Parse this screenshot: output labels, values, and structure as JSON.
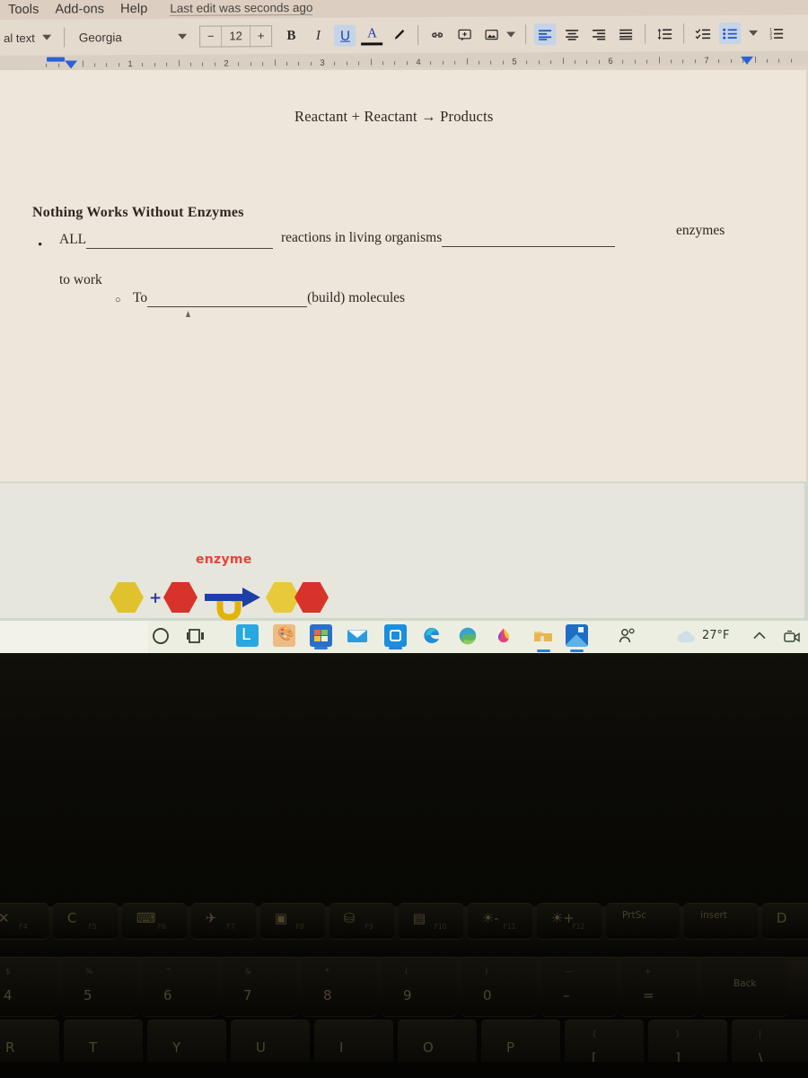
{
  "app": {
    "name": "Google Docs",
    "menu_items": [
      "Tools",
      "Add-ons",
      "Help"
    ],
    "last_edit": "Last edit was seconds ago"
  },
  "toolbar": {
    "paragraph_style": "al text",
    "font_family": "Georgia",
    "font_size": "12",
    "size_decrease": "−",
    "size_increase": "+",
    "bold_label": "B",
    "italic_label": "I",
    "underline_label": "U",
    "text_color_label": "A",
    "highlight_icon": "pen-highlight-icon",
    "link_icon": "insert-link-icon",
    "comment_icon": "add-comment-icon",
    "image_icon": "insert-image-icon",
    "align_left_icon": "align-left-icon",
    "align_center_icon": "align-center-icon",
    "align_right_icon": "align-right-icon",
    "align_justify_icon": "align-justify-icon",
    "line_spacing_icon": "line-spacing-icon",
    "checklist_icon": "checklist-icon",
    "bulleted_list_icon": "bulleted-list-icon",
    "numbered_list_icon": "numbered-list-icon",
    "active_buttons": [
      "underline",
      "align-left",
      "bulleted-list"
    ]
  },
  "ruler": {
    "numbers": [
      "1",
      "2",
      "3",
      "4",
      "5",
      "6",
      "7"
    ]
  },
  "document": {
    "equation_line": "Reactant + Reactant → Products",
    "heading": "Nothing Works Without Enzymes",
    "bullet_marker": "•",
    "sub_bullet_marker": "○",
    "line1_part1": "ALL",
    "line1_part2": "reactions in living organisms",
    "line1_part3": "enzymes",
    "line2": "to work",
    "line3_part1": "To",
    "line3_part2": "(build) molecules"
  },
  "figure": {
    "label": "enzyme",
    "label_color": "#e4443c",
    "plus_sign": "+",
    "shapes": [
      {
        "name": "substrate-a",
        "color": "#e3c game",
        "hex": "#e0c22e"
      },
      {
        "name": "substrate-b",
        "color": "#d8332a"
      },
      {
        "name": "product-a",
        "color": "#e8c93a"
      },
      {
        "name": "product-b",
        "color": "#d8332a"
      }
    ],
    "arrow_color": "#1f3fa8",
    "enzyme_arrow_color": "#e2b400"
  },
  "taskbar": {
    "icons": [
      "search-icon",
      "task-view-icon",
      "linkedin-app-icon",
      "paint-app-icon",
      "microsoft-store-icon",
      "mail-app-icon",
      "outlook-app-icon",
      "edge-browser-icon",
      "edge-beta-icon",
      "color-drop-icon",
      "file-explorer-icon",
      "photos-app-icon",
      "people-icon"
    ],
    "weather_temp": "27°F",
    "weather_icon": "cloud-icon",
    "show_hidden_icon": "chevron-up-icon",
    "camera_icon": "camera-privacy-icon"
  },
  "keyboard": {
    "function_row": [
      {
        "name": "f4-key",
        "glyph": "✕",
        "fn": "F4"
      },
      {
        "name": "f5-key",
        "glyph": "C",
        "fn": "F5"
      },
      {
        "name": "f6-key",
        "glyph": "⌨",
        "fn": "F6"
      },
      {
        "name": "f7-key",
        "glyph": "✈",
        "fn": "F7"
      },
      {
        "name": "f8-key",
        "glyph": "▣",
        "fn": "F8"
      },
      {
        "name": "f9-key",
        "glyph": "⛁",
        "fn": "F9"
      },
      {
        "name": "f10-key",
        "glyph": "▤",
        "fn": "F10"
      },
      {
        "name": "f11-key",
        "glyph": "☀-",
        "fn": "F11"
      },
      {
        "name": "f12-key",
        "glyph": "☀+",
        "fn": "F12"
      },
      {
        "name": "prtsc-key",
        "glyph": "PrtSc",
        "fn": ""
      },
      {
        "name": "insert-key",
        "glyph": "insert",
        "fn": ""
      },
      {
        "name": "delete-key",
        "glyph": "D",
        "fn": ""
      }
    ],
    "number_row": [
      {
        "name": "key-4",
        "shift": "$",
        "main": "4"
      },
      {
        "name": "key-5",
        "shift": "%",
        "main": "5"
      },
      {
        "name": "key-6",
        "shift": "^",
        "main": "6"
      },
      {
        "name": "key-7",
        "shift": "&",
        "main": "7"
      },
      {
        "name": "key-8",
        "shift": "*",
        "main": "8"
      },
      {
        "name": "key-9",
        "shift": "(",
        "main": "9"
      },
      {
        "name": "key-0",
        "shift": ")",
        "main": "0"
      },
      {
        "name": "key-minus",
        "shift": "—",
        "main": "–"
      },
      {
        "name": "key-equals",
        "shift": "+",
        "main": "="
      },
      {
        "name": "backspace-key",
        "shift": "",
        "main": "Back"
      }
    ],
    "letter_row": [
      {
        "name": "key-r",
        "main": "R"
      },
      {
        "name": "key-t",
        "main": "T"
      },
      {
        "name": "key-y",
        "main": "Y"
      },
      {
        "name": "key-u",
        "main": "U"
      },
      {
        "name": "key-i",
        "main": "I"
      },
      {
        "name": "key-o",
        "main": "O"
      },
      {
        "name": "key-p",
        "main": "P"
      },
      {
        "name": "key-lbracket",
        "shift": "{",
        "main": "["
      },
      {
        "name": "key-rbracket",
        "shift": "}",
        "main": "]"
      },
      {
        "name": "key-backslash",
        "shift": "|",
        "main": "\\"
      }
    ]
  }
}
